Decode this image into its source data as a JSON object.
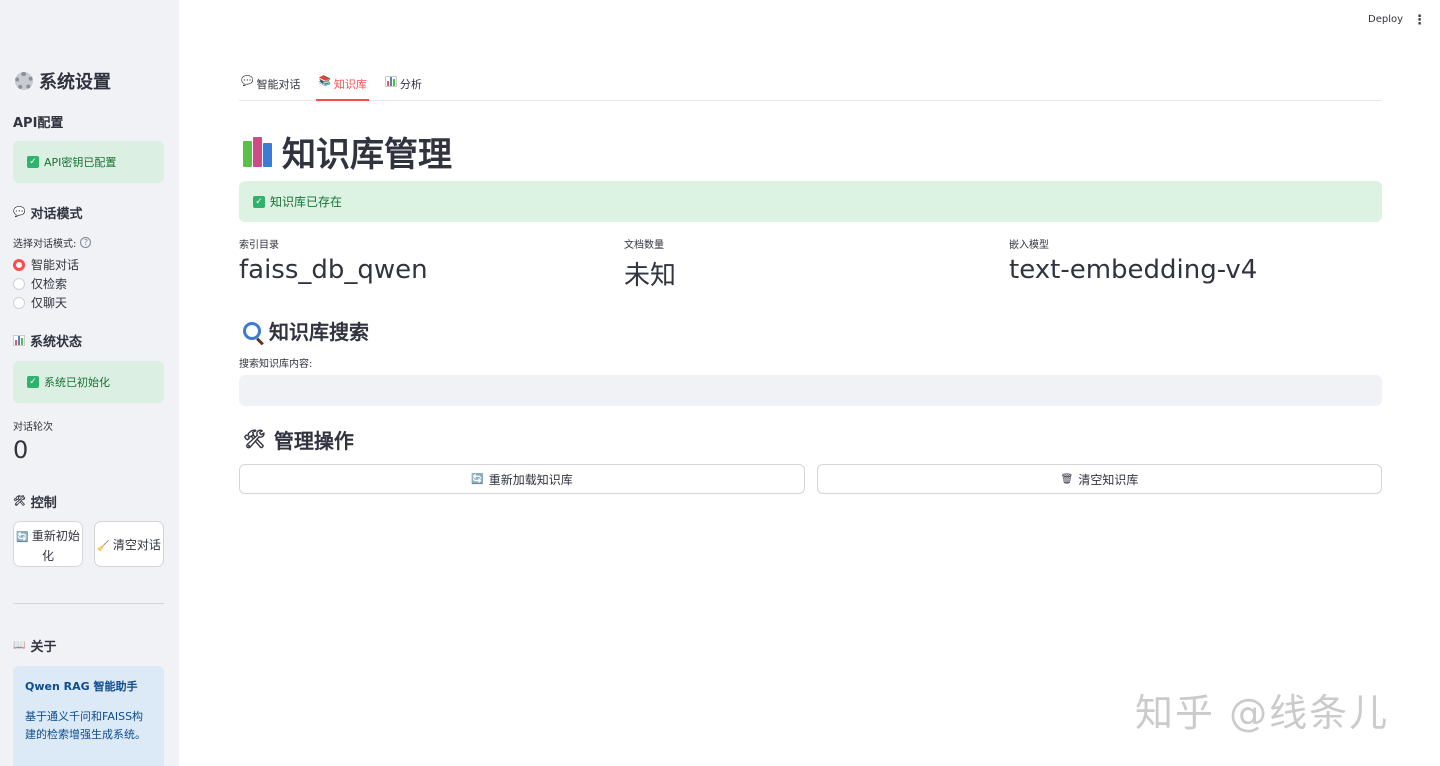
{
  "header": {
    "deploy_label": "Deploy",
    "menu_icon": "more-vertical-icon"
  },
  "sidebar": {
    "title": "系统设置",
    "api_section": "API配置",
    "api_status": "API密钥已配置",
    "mode_section": "对话模式",
    "mode_label": "选择对话模式:",
    "modes": [
      {
        "label": "智能对话",
        "selected": true
      },
      {
        "label": "仅检索",
        "selected": false
      },
      {
        "label": "仅聊天",
        "selected": false
      }
    ],
    "status_section": "系统状态",
    "system_status": "系统已初始化",
    "turns_label": "对话轮次",
    "turns_value": "0",
    "control_section": "控制",
    "reinit_button": "重新初始化",
    "clear_chat_button": "清空对话",
    "about_section": "关于",
    "about_title": "Qwen RAG 智能助手",
    "about_desc": "基于通义千问和FAISS构建的检索增强生成系统。"
  },
  "tabs": [
    {
      "label": "智能对话",
      "active": false
    },
    {
      "label": "知识库",
      "active": true
    },
    {
      "label": "分析",
      "active": false
    }
  ],
  "main": {
    "title": "知识库管理",
    "kb_status": "知识库已存在",
    "metrics": [
      {
        "label": "索引目录",
        "value": "faiss_db_qwen"
      },
      {
        "label": "文档数量",
        "value": "未知"
      },
      {
        "label": "嵌入模型",
        "value": "text-embedding-v4"
      }
    ],
    "search_title": "知识库搜索",
    "search_label": "搜索知识库内容:",
    "search_value": "",
    "manage_title": "管理操作",
    "reload_button": "重新加载知识库",
    "clear_kb_button": "清空知识库"
  },
  "watermark": "知乎 @线条儿",
  "colors": {
    "accent": "#ff4b4b",
    "success_bg": "#dcf3e3",
    "success_text": "#177233",
    "info_bg": "#dce9f6",
    "sidebar_bg": "#f0f2f6"
  }
}
